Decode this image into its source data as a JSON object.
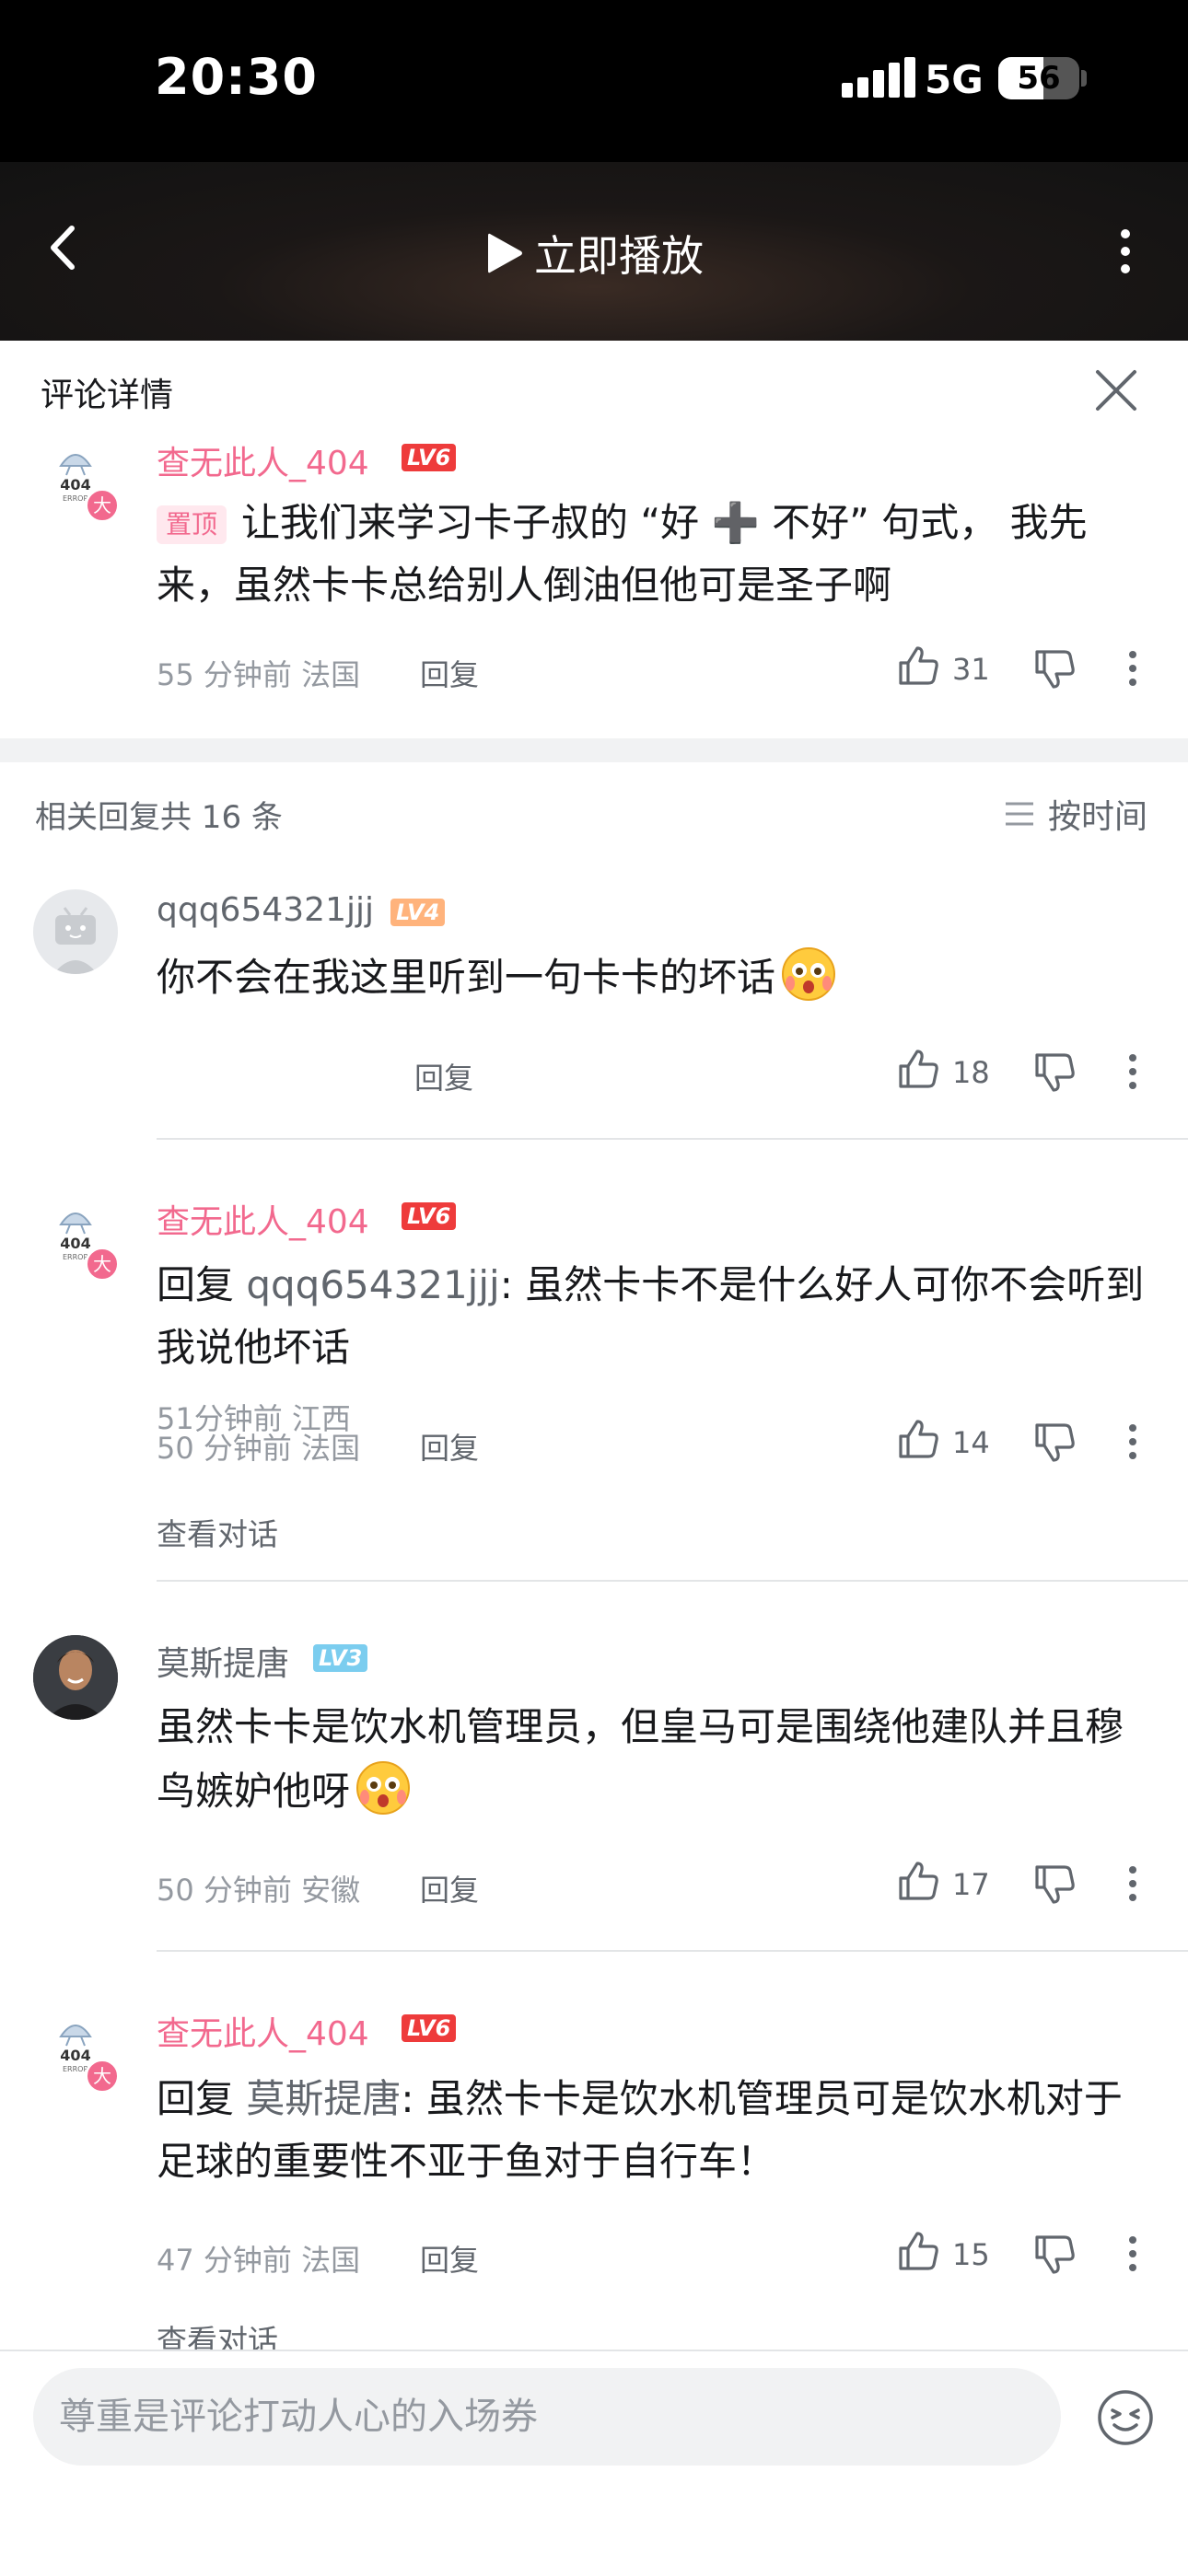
{
  "status": {
    "time": "20:30",
    "network": "5G",
    "battery": "56",
    "battery_level": 0.56
  },
  "topbar": {
    "play_label": "立即播放"
  },
  "sheet": {
    "title": "评论详情",
    "root": {
      "user": "查无此人_404",
      "level": "LV6",
      "avatar_badge": "大",
      "pin_tag": "置顶",
      "text": "让我们来学习卡子叔的 “好 ➕ 不好” 句式， 我先来，虽然卡卡总给别人倒油但他可是圣子啊",
      "meta": "55 分钟前  法国",
      "reply": "回复",
      "likes": "31"
    },
    "replies_count": "相关回复共 16 条",
    "sort_label": "按时间",
    "replies": [
      {
        "user": "qqq654321jjj",
        "level": "LV4",
        "text": "你不会在我这里听到一句卡卡的坏话",
        "meta": "51分钟前  江西",
        "reply": "回复",
        "likes": "18"
      },
      {
        "user": "查无此人_404",
        "level": "LV6",
        "avatar_badge": "大",
        "reply_prefix": "回复 ",
        "mention": "qqq654321jjj",
        "text": ": 虽然卡卡不是什么好人可你不会听到我说他坏话",
        "meta": "50 分钟前  法国",
        "reply": "回复",
        "likes": "14",
        "view_conversation": "查看对话"
      },
      {
        "user": "莫斯提唐",
        "level": "LV3",
        "text": "虽然卡卡是饮水机管理员，但皇马可是围绕他建队并且穆鸟嫉妒他呀",
        "meta": "50 分钟前  安徽",
        "reply": "回复",
        "likes": "17"
      },
      {
        "user": "查无此人_404",
        "level": "LV6",
        "avatar_badge": "大",
        "reply_prefix": "回复 ",
        "mention": "莫斯提唐",
        "text": ": 虽然卡卡是饮水机管理员可是饮水机对于足球的重要性不亚于鱼对于自行车！",
        "meta": "47 分钟前  法国",
        "reply": "回复",
        "likes": "15",
        "view_conversation": "查看对话"
      }
    ]
  },
  "input": {
    "placeholder": "尊重是评论打动人心的入场券"
  },
  "colors": {
    "pink": "#f2698e",
    "lv6": "#ee3b3b",
    "lv4": "#ffb37c",
    "lv3": "#7bcdef"
  }
}
